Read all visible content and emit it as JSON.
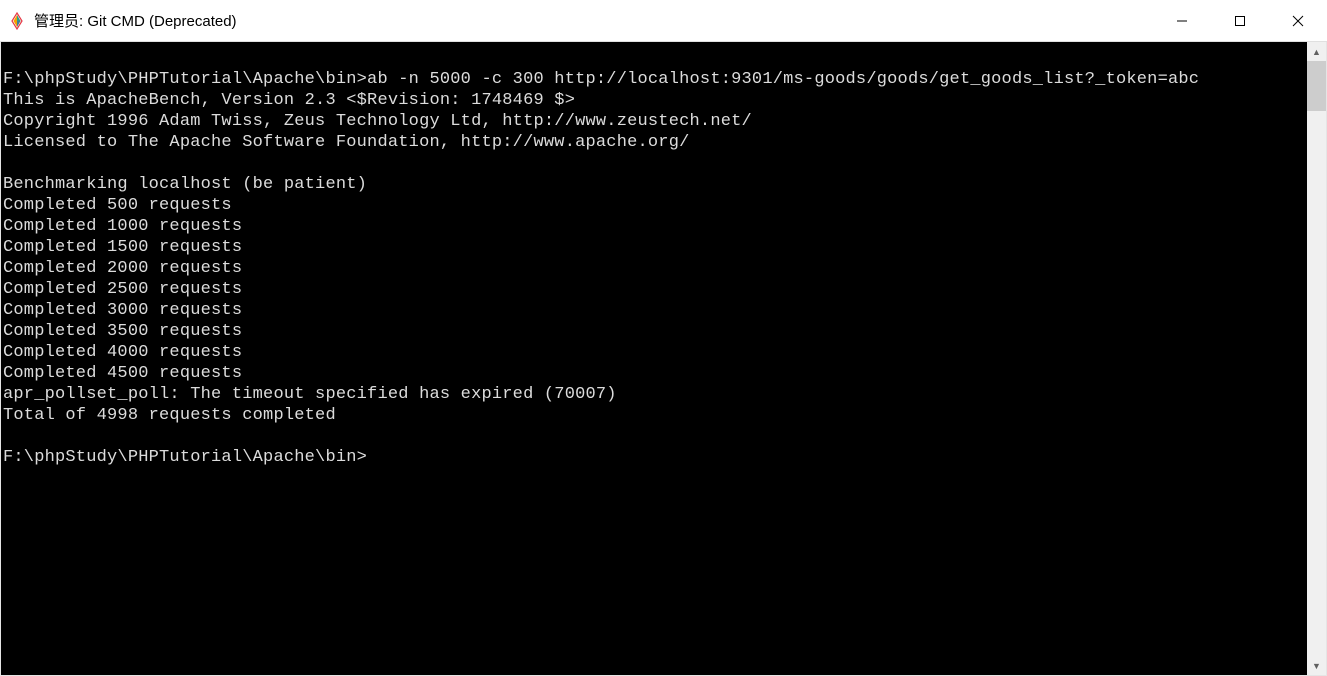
{
  "window": {
    "title": "管理员: Git CMD (Deprecated)"
  },
  "terminal": {
    "lines": [
      "",
      "F:\\phpStudy\\PHPTutorial\\Apache\\bin>ab -n 5000 -c 300 http://localhost:9301/ms-goods/goods/get_goods_list?_token=abc",
      "This is ApacheBench, Version 2.3 <$Revision: 1748469 $>",
      "Copyright 1996 Adam Twiss, Zeus Technology Ltd, http://www.zeustech.net/",
      "Licensed to The Apache Software Foundation, http://www.apache.org/",
      "",
      "Benchmarking localhost (be patient)",
      "Completed 500 requests",
      "Completed 1000 requests",
      "Completed 1500 requests",
      "Completed 2000 requests",
      "Completed 2500 requests",
      "Completed 3000 requests",
      "Completed 3500 requests",
      "Completed 4000 requests",
      "Completed 4500 requests",
      "apr_pollset_poll: The timeout specified has expired (70007)",
      "Total of 4998 requests completed",
      "",
      "F:\\phpStudy\\PHPTutorial\\Apache\\bin>"
    ]
  }
}
